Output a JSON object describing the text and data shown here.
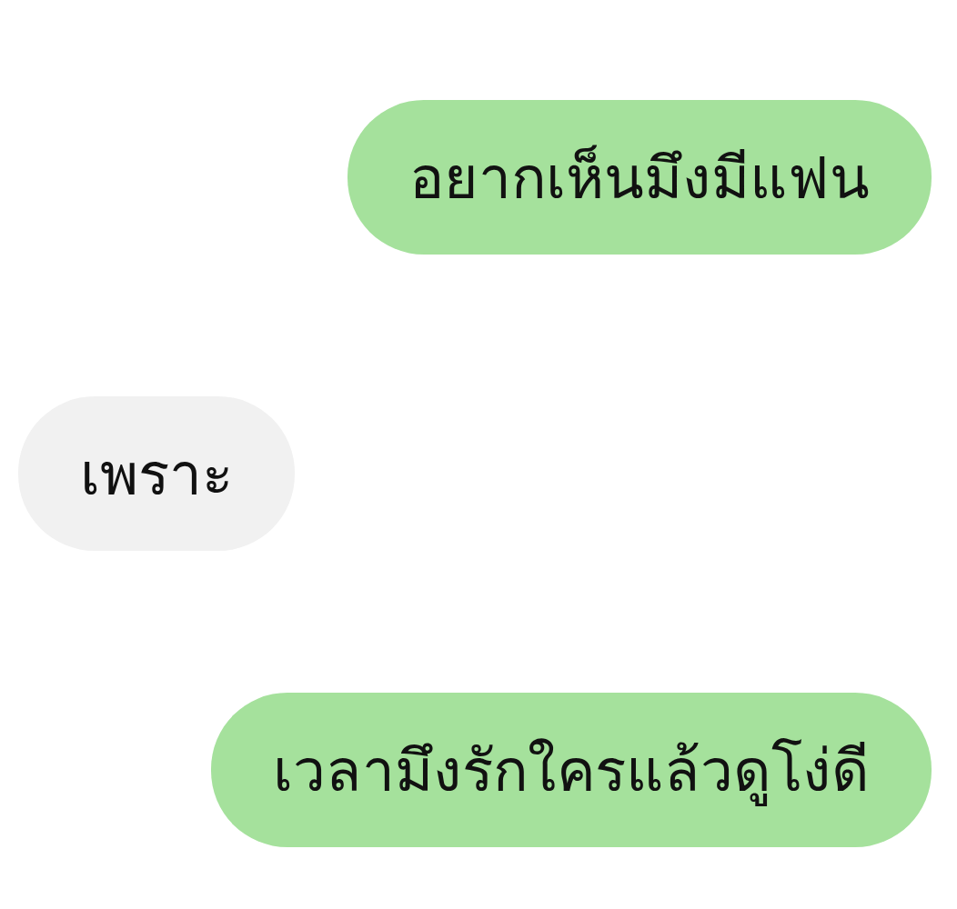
{
  "messages": [
    {
      "kind": "outgoing",
      "text": "อยากเห็นมึงมีแฟน"
    },
    {
      "kind": "incoming",
      "text": "เพราะ"
    },
    {
      "kind": "outgoing",
      "text": "เวลามึงรักใครแล้วดูโง่ดี"
    }
  ]
}
